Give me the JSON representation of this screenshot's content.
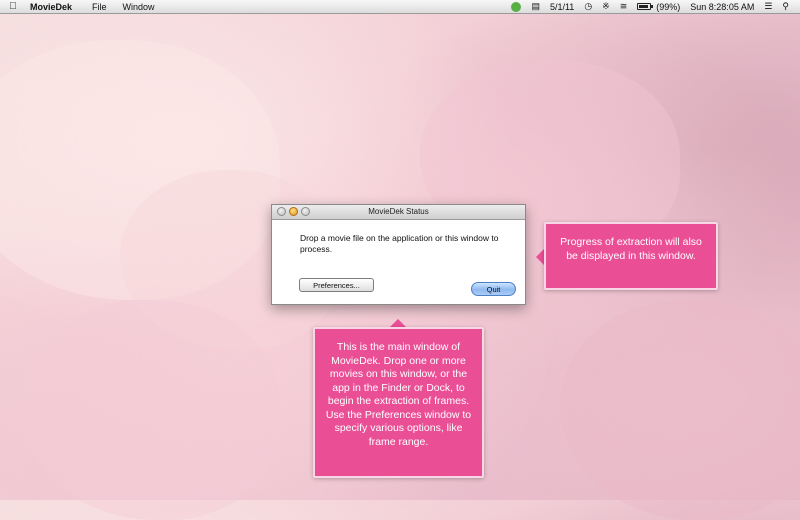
{
  "menubar": {
    "app_name": "MovieDek",
    "menus": [
      "File",
      "Window"
    ],
    "status": {
      "date": "5/1/11",
      "battery": "(99%)",
      "clock": "Sun 8:28:05 AM"
    }
  },
  "window": {
    "title": "MovieDek Status",
    "message": "Drop a movie file on the application or this window to process.",
    "preferences_label": "Preferences...",
    "quit_label": "Quit"
  },
  "callouts": {
    "right": "Progress of extraction will also be displayed in this window.",
    "bottom": "This is the main window of MovieDek. Drop one or more movies on this window, or the app in the Finder or Dock, to begin the extraction of frames. Use the Preferences window to specify various options, like frame range."
  },
  "colors": {
    "callout": "#ea4f96",
    "quit_button": "#8fb9ef"
  },
  "icons": [
    "apple-icon",
    "gear-icon",
    "display-icon",
    "time-machine-icon",
    "bluetooth-icon",
    "wifi-icon",
    "battery-icon",
    "menu-list-icon",
    "spotlight-icon"
  ]
}
